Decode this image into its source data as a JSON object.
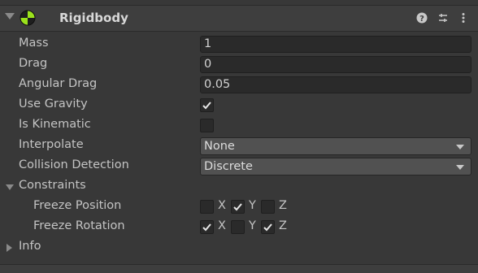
{
  "component": {
    "title": "Rigidbody",
    "icon": "rigidbody-icon",
    "header_buttons": [
      "help-icon",
      "preset-icon",
      "more-icon"
    ]
  },
  "fields": {
    "mass": {
      "label": "Mass",
      "value": "1"
    },
    "drag": {
      "label": "Drag",
      "value": "0"
    },
    "angular_drag": {
      "label": "Angular Drag",
      "value": "0.05"
    },
    "use_gravity": {
      "label": "Use Gravity",
      "checked": true
    },
    "is_kinematic": {
      "label": "Is Kinematic",
      "checked": false
    },
    "interpolate": {
      "label": "Interpolate",
      "value": "None"
    },
    "collision_detection": {
      "label": "Collision Detection",
      "value": "Discrete"
    }
  },
  "constraints": {
    "label": "Constraints",
    "expanded": true,
    "freeze_position": {
      "label": "Freeze Position",
      "x": false,
      "y": true,
      "z": false
    },
    "freeze_rotation": {
      "label": "Freeze Rotation",
      "x": true,
      "y": false,
      "z": true
    },
    "axis_labels": {
      "x": "X",
      "y": "Y",
      "z": "Z"
    }
  },
  "info": {
    "label": "Info",
    "expanded": false
  },
  "colors": {
    "background": "#383838",
    "field": "#2a2a2a",
    "dropdown": "#515151",
    "text": "#c4c4c4"
  }
}
